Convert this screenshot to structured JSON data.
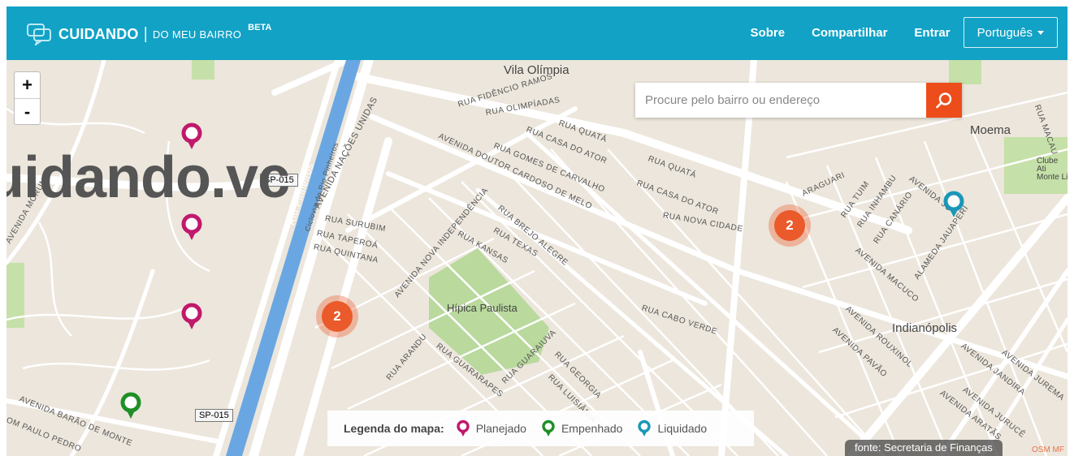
{
  "header": {
    "brand_name": "CUIDANDO",
    "brand_separator": "|",
    "brand_sub": "DO MEU BAIRRO",
    "brand_badge": "BETA",
    "nav": [
      "Sobre",
      "Compartilhar",
      "Entrar"
    ],
    "language": "Português"
  },
  "map": {
    "zoom_in": "+",
    "zoom_out": "-",
    "search_placeholder": "Procure pelo bairro ou endereço",
    "watermark": "uidando.vc",
    "clusters": [
      "2",
      "2"
    ],
    "places": {
      "vila_olimpia": "Vila Olímpia",
      "moema": "Moema",
      "hipica": "Hípica Paulista",
      "indianopolis": "Indianópolis",
      "clube": "Clube Ati Monte Li"
    },
    "shields": [
      "SP-015",
      "SP-015"
    ],
    "streets": [
      "RUA FIDÊNCIO RAMOS",
      "RUA OLIMPÍADAS",
      "RUA QUATÁ",
      "RUA CASA DO ATOR",
      "AVENIDA DOUTOR CARDOSO DE MELO",
      "RUA GOMES DE CARVALHO",
      "RUA QUATÁ",
      "RUA CASA DO ATOR",
      "RUA NOVA CIDADE",
      "AVENIDA NAÇÕES UNIDAS",
      "Rio Pinheiros",
      "Ciclovia do Rio Pinheiros",
      "RUA SURUBIM",
      "RUA TAPEROÁ",
      "RUA QUINTANA",
      "AVENIDA NOVA INDEPENDÊNCIA",
      "RUA KANSAS",
      "RUA TEXAS",
      "RUA BREJO ALEGRE",
      "RUA CABO VERDE",
      "RUA ARANDU",
      "RUA GUARARAPES",
      "RUA GUARAIUVA",
      "RUA GEORGIA",
      "RUA LUISIÂNIA",
      "ARAGUARI",
      "RUA TUIM",
      "RUA INHAMBU",
      "RUA CANÁRIO",
      "AVENIDA MACUCO",
      "ALAMEDA JAUAPERI",
      "AVENIDA ROUXINOL",
      "AVENIDA PAVÃO",
      "AVENIDA JANDIRA",
      "AVENIDA JUREMA",
      "AVENIDA JURUCÊ",
      "AVENIDA ARATÃS",
      "AVENIDA MORUMBI",
      "AVENIDA BARÃO DE MONTE",
      "OM PAULO PEDRO",
      "RUA MACAU",
      "AVENIDA JU"
    ],
    "legend": {
      "title": "Legenda do mapa:",
      "items": [
        {
          "label": "Planejado",
          "color": "#c0196b"
        },
        {
          "label": "Empenhado",
          "color": "#1f8f27"
        },
        {
          "label": "Liquidado",
          "color": "#1b97b8"
        }
      ]
    },
    "source": "fonte: Secretaria de Finanças",
    "attribution": "OSM MF",
    "colors": {
      "header": "#11a2c6",
      "search_button": "#ed4d1b",
      "cluster": "#ea5a2a",
      "river": "#6aa7e2",
      "park": "#b9d99d",
      "road": "#ffffff"
    }
  }
}
